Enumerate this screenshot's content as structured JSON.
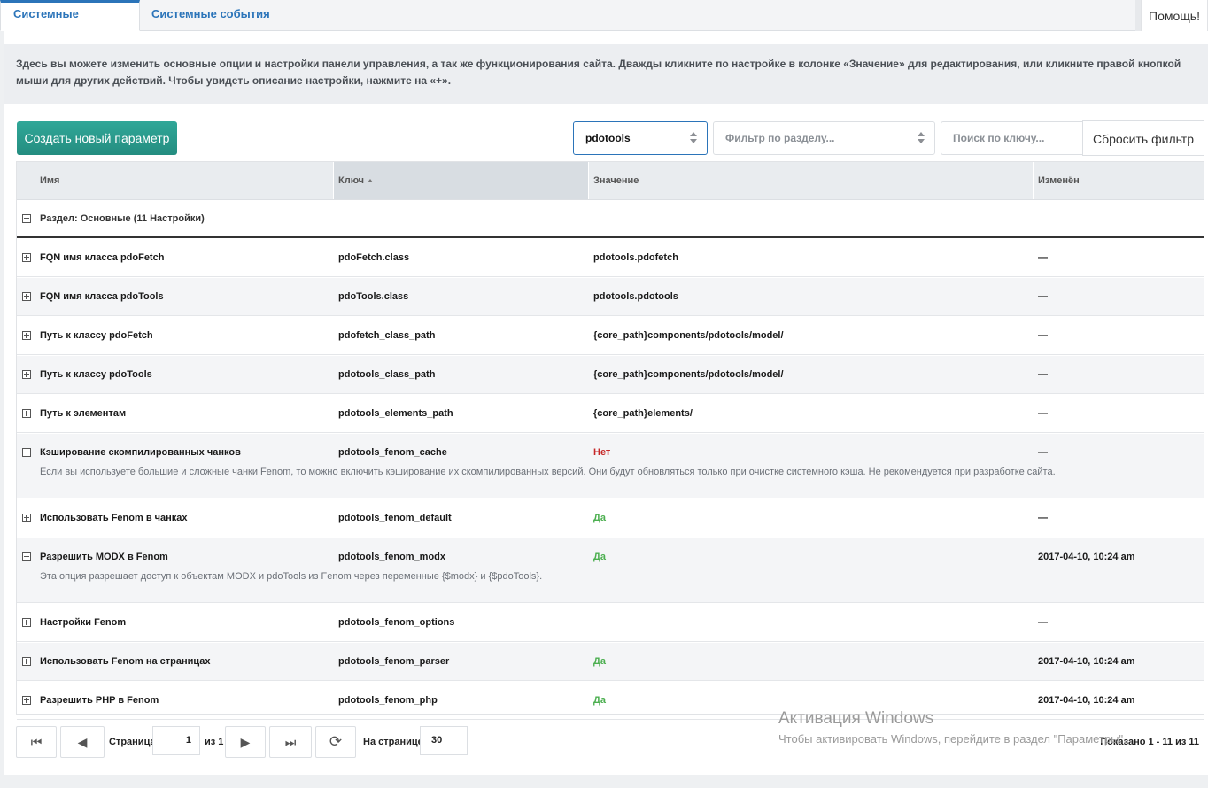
{
  "tabs": [
    {
      "label": "Системные настройки",
      "active": true
    },
    {
      "label": "Системные события",
      "active": false
    }
  ],
  "help_label": "Помощь!",
  "description": "Здесь вы можете изменить основные опции и настройки панели управления, а так же функционирования сайта. Дважды кликните по настройке в колонке «Значение» для редактирования, или кликните правой кнопкой мыши для других действий. Чтобы увидеть описание настройки, нажмите на «+».",
  "toolbar": {
    "create_label": "Создать новый параметр",
    "namespace_value": "pdotools",
    "area_placeholder": "Фильтр по разделу...",
    "search_placeholder": "Поиск по ключу...",
    "reset_label": "Сбросить фильтр"
  },
  "columns": {
    "name": "Имя",
    "key": "Ключ",
    "value": "Значение",
    "modified": "Изменён"
  },
  "group_label": "Раздел: Основные (11 Настройки)",
  "rows": [
    {
      "name": "FQN имя класса pdoFetch",
      "key": "pdoFetch.class",
      "value": "pdotools.pdofetch",
      "modified": "—",
      "expanded": false,
      "description": ""
    },
    {
      "name": "FQN имя класса pdoTools",
      "key": "pdoTools.class",
      "value": "pdotools.pdotools",
      "modified": "—",
      "expanded": false,
      "description": ""
    },
    {
      "name": "Путь к классу pdoFetch",
      "key": "pdofetch_class_path",
      "value": "{core_path}components/pdotools/model/",
      "modified": "—",
      "expanded": false,
      "description": ""
    },
    {
      "name": "Путь к классу pdoTools",
      "key": "pdotools_class_path",
      "value": "{core_path}components/pdotools/model/",
      "modified": "—",
      "expanded": false,
      "description": ""
    },
    {
      "name": "Путь к элементам",
      "key": "pdotools_elements_path",
      "value": "{core_path}elements/",
      "modified": "—",
      "expanded": false,
      "description": ""
    },
    {
      "name": "Кэширование скомпилированных чанков",
      "key": "pdotools_fenom_cache",
      "value": "Нет",
      "value_style": "no",
      "modified": "—",
      "expanded": true,
      "description": "Если вы используете большие и сложные чанки Fenom, то можно включить кэширование их скомпилированных версий. Они будут обновляться только при очистке системного кэша. Не рекомендуется при разработке сайта."
    },
    {
      "name": "Использовать Fenom в чанках",
      "key": "pdotools_fenom_default",
      "value": "Да",
      "value_style": "yes",
      "modified": "—",
      "expanded": false,
      "description": ""
    },
    {
      "name": "Разрешить MODX в Fenom",
      "key": "pdotools_fenom_modx",
      "value": "Да",
      "value_style": "yes",
      "modified": "2017-04-10, 10:24 am",
      "expanded": true,
      "description": "Эта опция разрешает доступ к объектам MODX и pdoTools из Fenom через переменные {$modx} и {$pdoTools}."
    },
    {
      "name": "Настройки Fenom",
      "key": "pdotools_fenom_options",
      "value": "",
      "modified": "—",
      "expanded": false,
      "description": ""
    },
    {
      "name": "Использовать Fenom на страницах",
      "key": "pdotools_fenom_parser",
      "value": "Да",
      "value_style": "yes",
      "modified": "2017-04-10, 10:24 am",
      "expanded": false,
      "description": ""
    },
    {
      "name": "Разрешить PHP в Fenom",
      "key": "pdotools_fenom_php",
      "value": "Да",
      "value_style": "yes",
      "modified": "2017-04-10, 10:24 am",
      "expanded": false,
      "description": ""
    }
  ],
  "pager": {
    "page_label": "Страница",
    "page_value": "1",
    "of_label": "из 1",
    "per_page_label": "На странице:",
    "per_page_value": "30",
    "info": "Показано 1 - 11 из 11"
  },
  "watermark": {
    "line1": "Активация Windows",
    "line2": "Чтобы активировать Windows, перейдите в раздел \"Параметры\"."
  }
}
